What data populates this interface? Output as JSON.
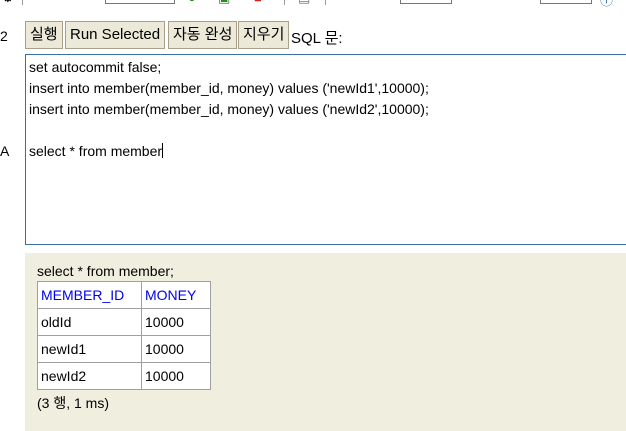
{
  "toolbar": {
    "buttons": {
      "run": "실행",
      "run_selected": "Run Selected",
      "auto_complete": "자동 완성",
      "clear": "지우기"
    },
    "sql_label": "SQL 문:"
  },
  "gutter": {
    "line_number": "2",
    "marker": "A"
  },
  "editor": {
    "lines": [
      "set autocommit false;",
      "insert into member(member_id, money) values ('newId1',10000);",
      "insert into member(member_id, money) values ('newId2',10000);",
      "",
      "select * from member"
    ]
  },
  "result": {
    "query": "select * from member;",
    "columns": [
      "MEMBER_ID",
      "MONEY"
    ],
    "rows": [
      [
        "oldId",
        "10000"
      ],
      [
        "newId1",
        "10000"
      ],
      [
        "newId2",
        "10000"
      ]
    ],
    "summary": "(3 행, 1 ms)"
  },
  "colors": {
    "editor_border": "#3a6ea5",
    "result_background": "#f0eedf",
    "header_link": "#0000ee",
    "button_background": "#ece9d8"
  }
}
